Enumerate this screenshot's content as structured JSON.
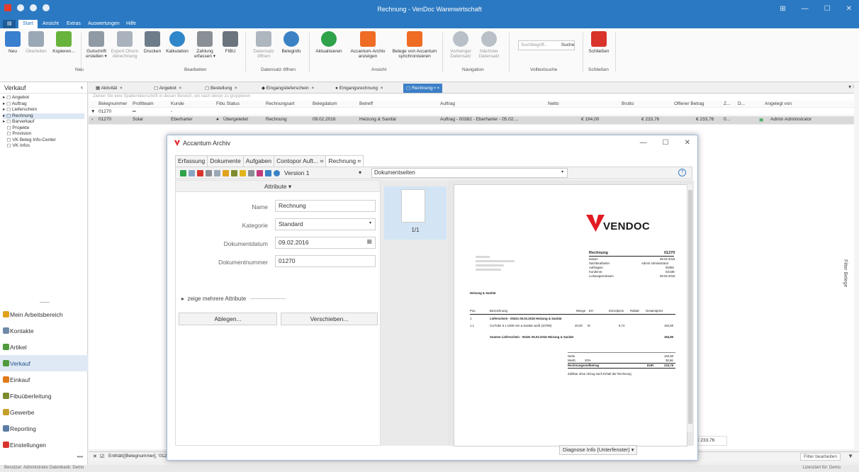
{
  "window": {
    "title": "Rechnung - VenDoc Warenwirtschaft",
    "min": "—",
    "max": "☐",
    "close": "✕",
    "extra": "⊞"
  },
  "ribbon_tabs": [
    {
      "label": "Start"
    },
    {
      "label": "Ansicht"
    },
    {
      "label": "Extras"
    },
    {
      "label": "Auswertungen"
    },
    {
      "label": "Hilfe"
    }
  ],
  "ribbon": {
    "buttons": [
      {
        "label": "Neu",
        "color": "#3a7fd0"
      },
      {
        "label": "Überleiten",
        "color": "#9aa7b5"
      },
      {
        "label": "Kopieren...",
        "color": "#68b33b"
      },
      {
        "label": "Gutschrift erstellen ▾",
        "color": "#8f9aa5"
      },
      {
        "label": "Export Ohorn Abrechnung",
        "color": "#aab3bd"
      },
      {
        "label": "Drucken",
        "color": "#6e7c8a"
      },
      {
        "label": "Kalkulation",
        "color": "#2f86c9"
      },
      {
        "label": "Zahlung erfassen ▾",
        "color": "#8a8f95"
      },
      {
        "label": "FIBU",
        "color": "#6b747d"
      },
      {
        "label": "Datensatz öffnen",
        "color": "#aeb6be"
      },
      {
        "label": "Beleginfo",
        "color": "#3b82c4"
      },
      {
        "label": "Aktualisieren",
        "color": "#2fa24a"
      },
      {
        "label": "Accantum-Archiv anzeigen",
        "color": "#ef6c24"
      },
      {
        "label": "Belege von Accantum synchronisieren",
        "color": "#ef6c24"
      },
      {
        "label": "Vorheriger Datensatz",
        "color": "#b9c0c7"
      },
      {
        "label": "Nächster Datensatz",
        "color": "#b9c0c7"
      },
      {
        "label": "Schließen",
        "color": "#d9342b"
      }
    ],
    "groups": [
      "Neu",
      "Bearbeiten",
      "Datensatz öffnen",
      "Ansicht",
      "Navigation",
      "Volltextsuche",
      "Schließen"
    ],
    "search_placeholder": "Suchbegriff...",
    "search_button": "Suche"
  },
  "nav": {
    "header": "Verkauf",
    "tree": [
      "Angebot",
      "Auftrag",
      "Lieferschein",
      "Rechnung",
      "Barverkauf",
      "Projekte",
      "Provision",
      "VK Beleg Info-Center",
      "VK Infos"
    ],
    "modules": [
      {
        "label": "Mein Arbeitsbereich",
        "color": "#e0a21b"
      },
      {
        "label": "Kontakte",
        "color": "#6f8aa8"
      },
      {
        "label": "Artikel",
        "color": "#4f9a3a"
      },
      {
        "label": "Verkauf",
        "color": "#4f9a3a"
      },
      {
        "label": "Einkauf",
        "color": "#e07a1b"
      },
      {
        "label": "Fibuüberleitung",
        "color": "#7d8b2e"
      },
      {
        "label": "Gewerbe",
        "color": "#c4a02a"
      },
      {
        "label": "Reporting",
        "color": "#5a7ba3"
      },
      {
        "label": "Einstellungen",
        "color": "#d9342b"
      }
    ],
    "more": "•••"
  },
  "doctabs": [
    "Aktivität",
    "Angebot",
    "Bestellung",
    "Eingangslieferschein",
    "Eingangsrechnung",
    "Rechnung"
  ],
  "grid": {
    "group_hint": "Ziehen Sie eine Spaltenüberschrift in diesen Bereich, um nach dieser zu gruppieren",
    "headers": [
      "Belegnummer",
      "Profitteam",
      "Kunde",
      "Fibu Status",
      "Rechnungsart",
      "Belegdatum",
      "Betreff",
      "Auftrag",
      "Netto",
      "Brutto",
      "Offener Betrag",
      "Z...",
      "D...",
      "Angelegt von"
    ],
    "filter_value": "01270",
    "row": {
      "belegnummer": "01270",
      "profitteam": "Solar",
      "kunde": "Eberharter",
      "fibu": "Übergeleitet",
      "art": "Rechnung",
      "datum": "09.02.2016",
      "betreff": "Heizung & Sanitär",
      "auftrag": "Auftrag - 00382 - Eberharter - 05.02....",
      "netto": "€ 194,00",
      "brutto": "€ 233,76",
      "offen": "€ 233,76",
      "z": "0...",
      "von": "Admin Administrator"
    },
    "bottom_total": "€ 233,76",
    "filter_expression": "Enthält([Belegnummer], '01270')"
  },
  "right_panel": {
    "label": "Filter Belege"
  },
  "bottombar": {
    "filter_button": "Filter bearbeiten"
  },
  "status": {
    "left": "Benutzer: Administrator  Datenbank: Demo",
    "right": "Lizenziert für: Demo"
  },
  "dialog": {
    "title": "Accantum Archiv",
    "tabs": [
      "Erfassung",
      "Dokumente",
      "Aufgaben",
      "Contopor Auft...",
      "Rechnung"
    ],
    "version": "Version 1",
    "docselect": "Dokumentseiten",
    "attr_header": "Attribute ▾",
    "fields": [
      {
        "label": "Name",
        "value": "Rechnung"
      },
      {
        "label": "Kategorie",
        "value": "Standard"
      },
      {
        "label": "Dokumentdatum",
        "value": "09.02.2016"
      },
      {
        "label": "Dokumentnummer",
        "value": "01270"
      }
    ],
    "more_attrs": "zeige mehrere Attribute",
    "btn_file": "Ablegen...",
    "btn_move": "Verschieben...",
    "thumb_page": "1/1",
    "diag": "Diagnose Info (Unterfenster) ▾"
  },
  "invoice": {
    "brand": "VENDOC",
    "title": "Rechnung",
    "number": "01270",
    "meta": [
      {
        "k": "Datum",
        "v": "09.02.2016"
      },
      {
        "k": "Sachbearbeiter",
        "v": "Admin Administrator"
      },
      {
        "k": "Auftragsnr.",
        "v": "00382"
      },
      {
        "k": "Kundennr.",
        "v": "D4438"
      },
      {
        "k": "Leistungszeitraum",
        "v": "09.02.2016"
      }
    ],
    "subject": "Heizung & Sanitär",
    "cols": [
      "Pos.",
      "Bezeichnung",
      "Menge",
      "EH",
      "Einzelpreis",
      "Rabatt",
      "Gesamtpreis"
    ],
    "pos1": "1",
    "pos1_text": "Lieferschein - 00431 05.02.2016 Heizung & Sanitär",
    "pos11": "1.1",
    "pos11_text": "CurTube 6 x 1000 mm a.Sanitär weiß (10799)",
    "pos11_qty": "20,00",
    "pos11_eh": "M",
    "pos11_price": "9,74",
    "pos11_total": "194,80",
    "sum_text": "Summe Lieferschein - 00431 05.02.2016 Heizung & Sanitär",
    "sum_value": "194,80",
    "netto_k": "Netto",
    "netto_v": "194,80",
    "mwst_k": "MwSt.",
    "mwst_p": "20%",
    "mwst_v": "38,96",
    "total_k": "Rechnungsendbetrag",
    "total_cur": "EUR",
    "total_v": "233,76",
    "terms": "Zahlbar ohne Abzug nach Erhalt der Rechnung"
  }
}
